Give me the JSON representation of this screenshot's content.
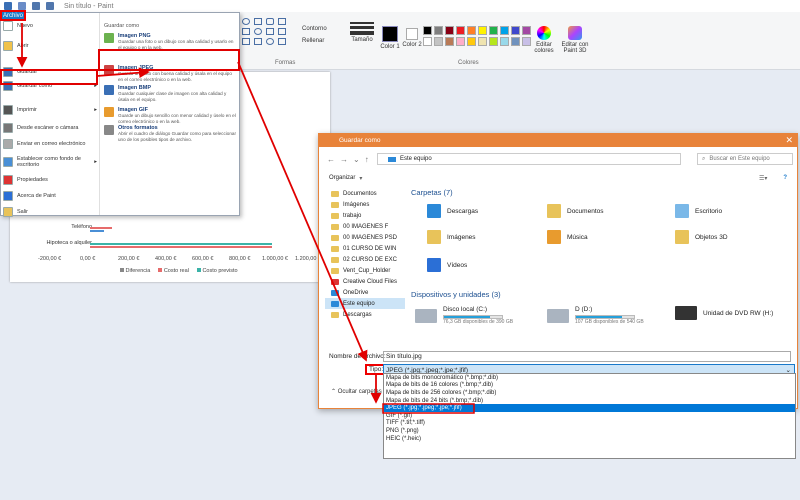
{
  "app": {
    "title": "Sin título - Paint",
    "file_tab_label": "Archivo"
  },
  "ribbon": {
    "outline_label": "Contorno",
    "fill_label": "Rellenar",
    "size_label": "Tamaño",
    "color1_label": "Color 1",
    "color2_label": "Color 2",
    "edit_colors_label": "Editar colores",
    "edit_paint3d_label": "Editar con Paint 3D",
    "shapes_group": "Formas",
    "colors_group": "Colores",
    "palette": [
      "#000000",
      "#7f7f7f",
      "#880015",
      "#ed1c24",
      "#ff7f27",
      "#fff200",
      "#22b14c",
      "#00a2e8",
      "#3f48cc",
      "#a349a4",
      "#ffffff",
      "#c3c3c3",
      "#b97a57",
      "#ffaec9",
      "#ffc90e",
      "#efe4b0",
      "#b5e61d",
      "#99d9ea",
      "#7092be",
      "#c8bfe7"
    ]
  },
  "file_menu": {
    "left_items": [
      {
        "label": "Nuevo",
        "icon": "new-file-icon"
      },
      {
        "label": "Abrir",
        "icon": "open-folder-icon"
      },
      {
        "label": "Guardar",
        "icon": "save-icon"
      },
      {
        "label": "Guardar como",
        "icon": "save-as-icon"
      },
      {
        "label": "Imprimir",
        "icon": "print-icon"
      },
      {
        "label": "Desde escáner o cámara",
        "icon": "scanner-icon"
      },
      {
        "label": "Enviar en correo electrónico",
        "icon": "email-icon"
      },
      {
        "label": "Establecer como fondo de escritorio",
        "icon": "desktop-icon"
      },
      {
        "label": "Propiedades",
        "icon": "properties-icon"
      },
      {
        "label": "Acerca de Paint",
        "icon": "about-icon"
      },
      {
        "label": "Salir",
        "icon": "exit-icon"
      }
    ],
    "right_header": "Guardar como",
    "options": [
      {
        "title": "Imagen PNG",
        "desc": "Guardar una foto o un dibujo con alta calidad y usarlo en el equipo o en la web."
      },
      {
        "title": "Imagen JPEG",
        "desc": "Guarda una foto con buena calidad y úsala en el equipo en el correo electrónico o en la web."
      },
      {
        "title": "Imagen BMP",
        "desc": "Guardar cualquier clase de imagen con alta calidad y úsala en el equipo."
      },
      {
        "title": "Imagen GIF",
        "desc": "Guarde un dibujo sencillo con menor calidad y úselo en el correo electrónico o en la web."
      },
      {
        "title": "Otros formatos",
        "desc": "Abrir el cuadro de diálogo Guardar como para seleccionar uno de los posibles tipos de archivo."
      }
    ]
  },
  "canvas_chart": {
    "row_labels": [
      "Teléfono",
      "Hipoteca o alquiler"
    ],
    "ticks": [
      "-200,00 €",
      "0,00 €",
      "200,00 €",
      "400,00 €",
      "600,00 €",
      "800,00 €",
      "1.000,00 €",
      "1.200,00 €"
    ],
    "legend": [
      "Diferencia",
      "Costo real",
      "Costo previsto"
    ]
  },
  "dialog": {
    "title": "Guardar como",
    "address": "Este equipo",
    "search_placeholder": "Buscar en Este equipo",
    "organize_label": "Organizar",
    "nav_items": [
      "Documentos",
      "Imágenes",
      "trabajo",
      "00 IMAGENES F",
      "00 IMAGENES PSD",
      "01 CURSO DE WIN",
      "02 CURSO DE EXC",
      "Vent_Cup_Holder",
      "Creative Cloud Files",
      "OneDrive",
      "Este equipo",
      "Descargas"
    ],
    "folders_header": "Carpetas (7)",
    "folders": [
      "Descargas",
      "Documentos",
      "Escritorio",
      "Imágenes",
      "Música",
      "Objetos 3D",
      "Vídeos"
    ],
    "drives_header": "Dispositivos y unidades (3)",
    "drives": [
      {
        "name": "Disco local (C:)",
        "free": "76,3 GB disponibles de 390 GB",
        "used_fraction": 0.8
      },
      {
        "name": "D (D:)",
        "free": "107 GB disponibles de 540 GB",
        "used_fraction": 0.8
      },
      {
        "name": "Unidad de DVD RW (H:)",
        "free": "",
        "used_fraction": null
      }
    ],
    "filename_label": "Nombre de archivo:",
    "filename_value": "Sin título.jpg",
    "type_label": "Tipo:",
    "type_value": "JPEG (*.jpg;*.jpeg;*.jpe;*.jfif)",
    "hide_folders_label": "Ocultar carpetas",
    "type_options": [
      "Mapa de bits monocromático (*.bmp;*.dib)",
      "Mapa de bits de 16 colores (*.bmp;*.dib)",
      "Mapa de bits de 256 colores (*.bmp;*.dib)",
      "Mapa de bits de 24 bits (*.bmp;*.dib)",
      "JPEG (*.jpg;*.jpeg;*.jpe;*.jfif)",
      "GIF (*.gif)",
      "TIFF (*.tif;*.tiff)",
      "PNG (*.png)",
      "HEIC (*.heic)"
    ],
    "selected_type_index": 4
  },
  "colors": {
    "highlight_red": "#e00000",
    "dialog_accent": "#e8833a",
    "win_blue": "#0078d7"
  }
}
